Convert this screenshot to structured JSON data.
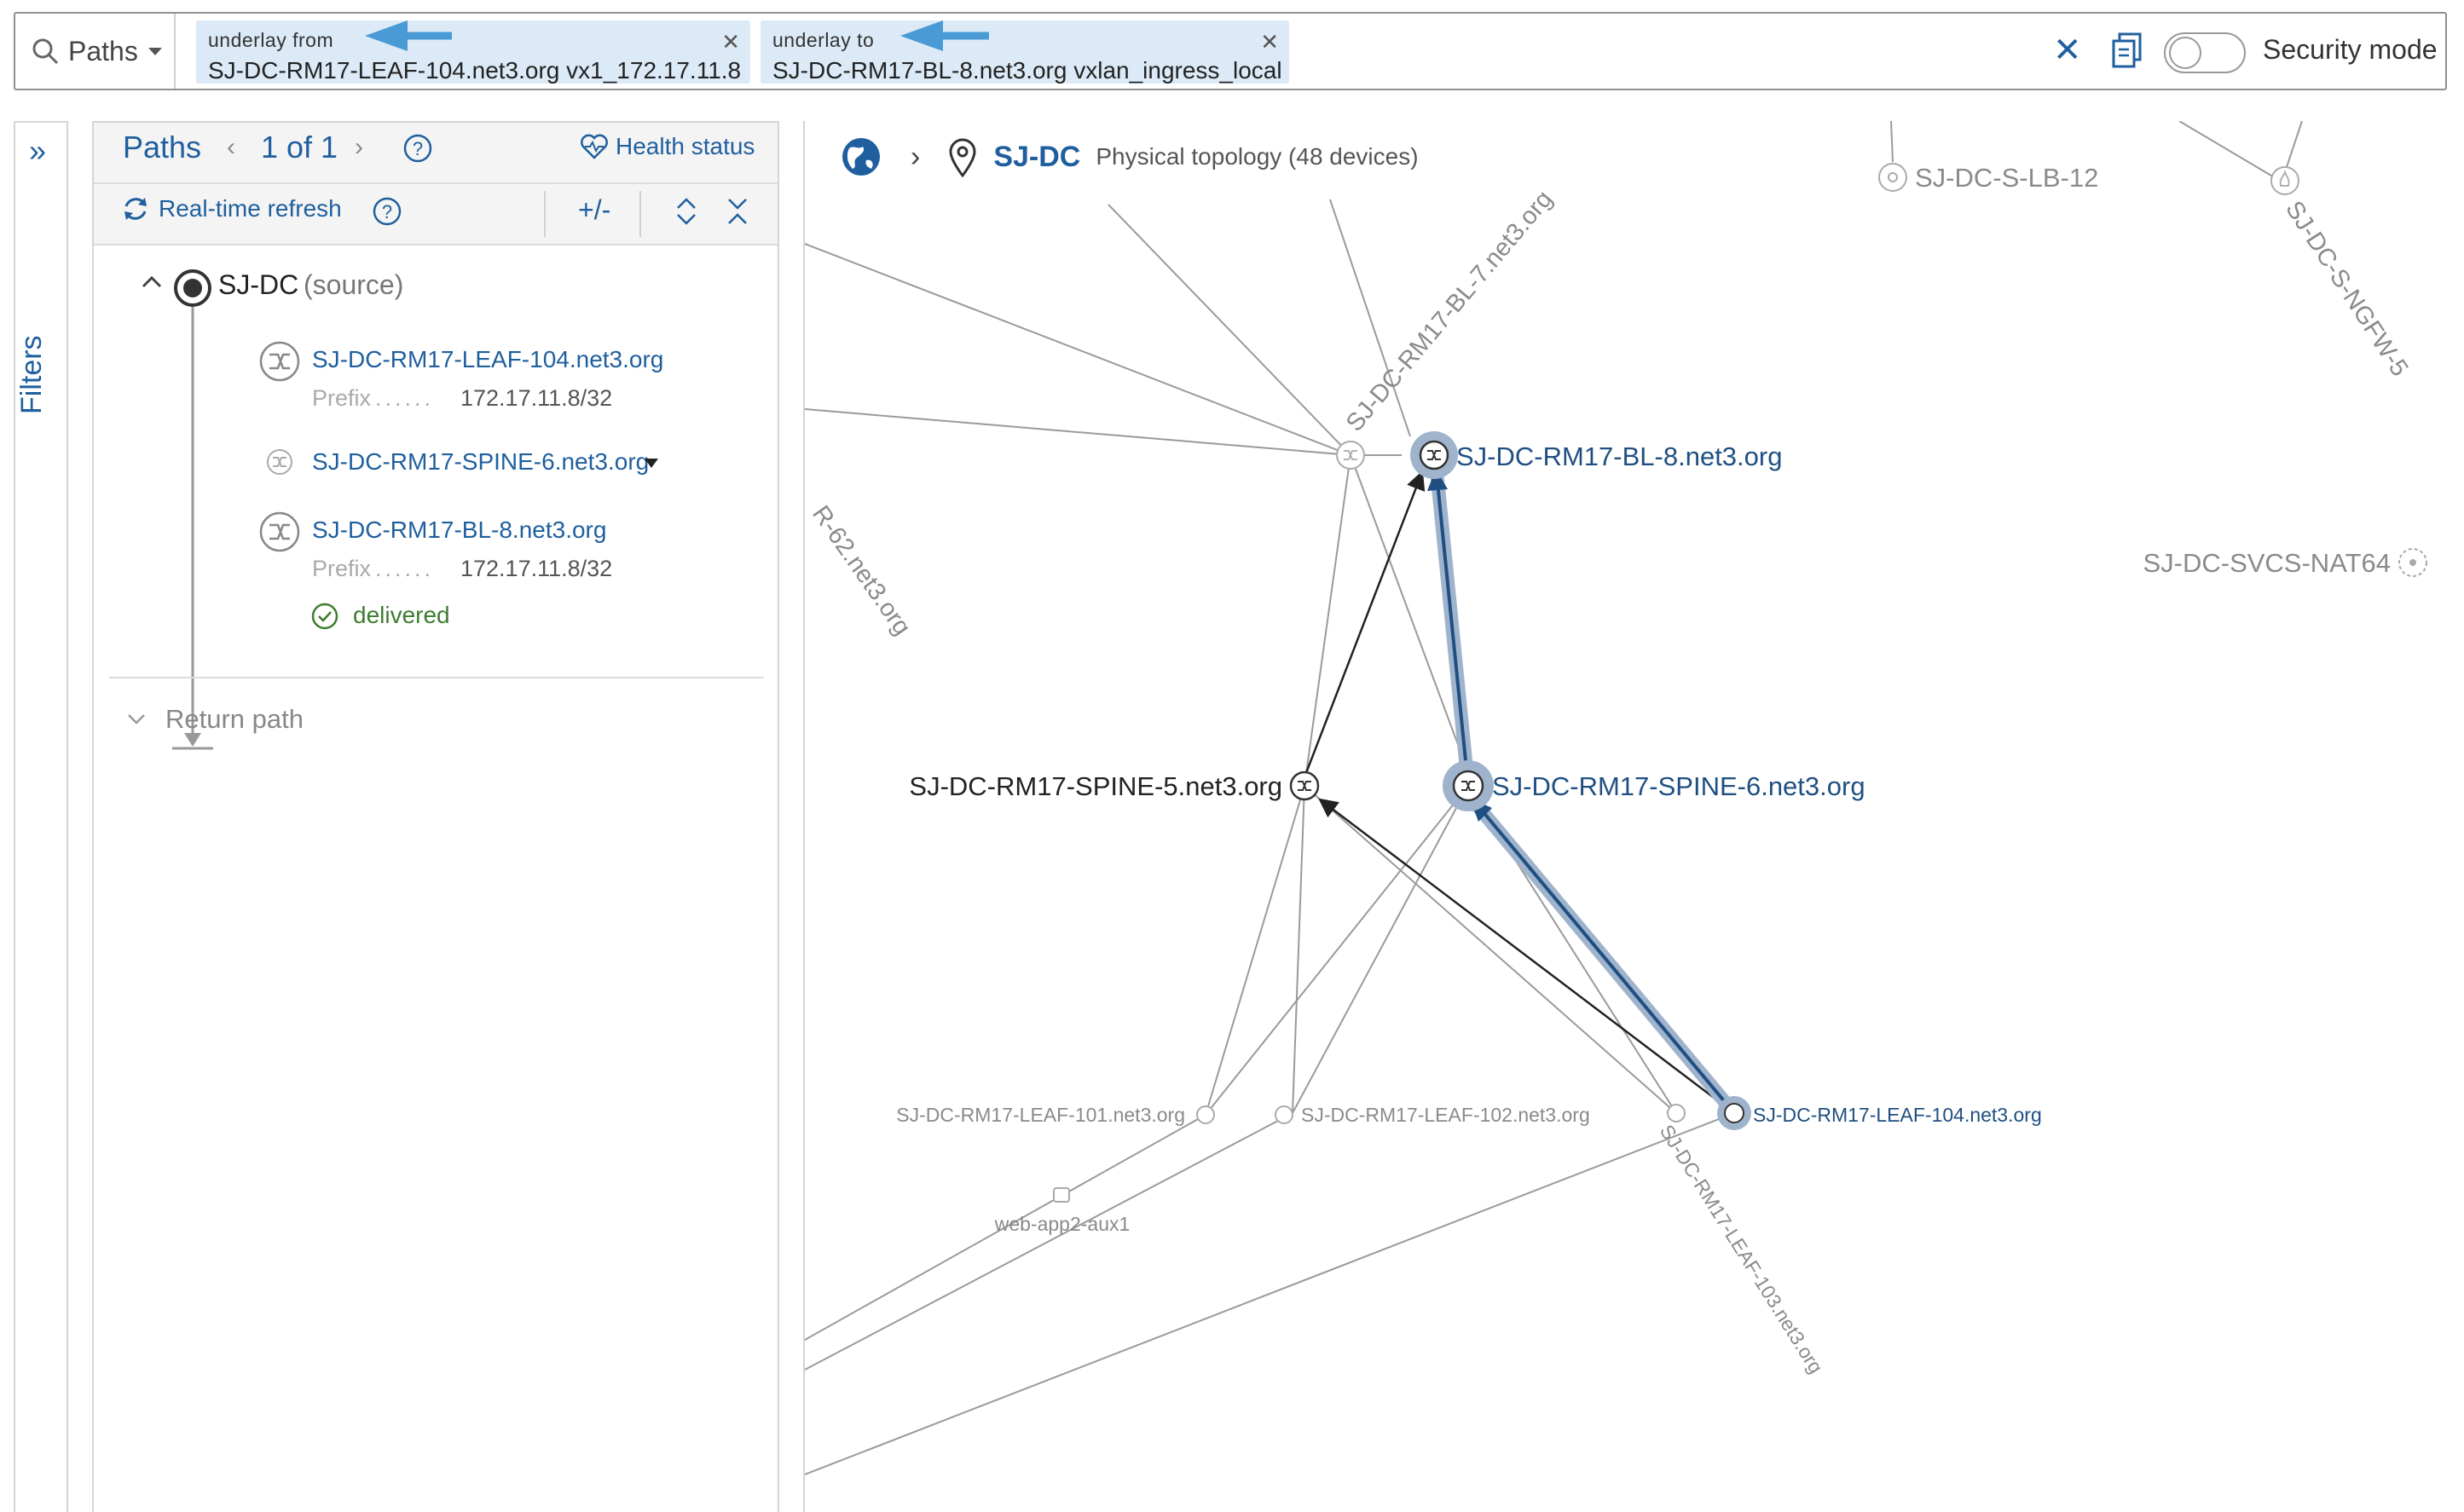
{
  "search": {
    "scope_label": "Paths",
    "chips": [
      {
        "label": "underlay  from",
        "value": "SJ-DC-RM17-LEAF-104.net3.org vx1_172.17.11.8"
      },
      {
        "label": "underlay  to",
        "value": "SJ-DC-RM17-BL-8.net3.org vxlan_ingress_local"
      }
    ],
    "security_mode_label": "Security mode"
  },
  "filters": {
    "label": "Filters"
  },
  "paths_panel": {
    "title": "Paths",
    "page": "1 of 1",
    "health_status_label": "Health status",
    "realtime_refresh_label": "Real-time refresh",
    "plus_minus_label": "+/-",
    "tree": {
      "source_name": "SJ-DC",
      "source_suffix": "(source)",
      "hops": [
        {
          "name": "SJ-DC-RM17-LEAF-104.net3.org",
          "prefix_label": "Prefix",
          "prefix_value": "172.17.11.8/32"
        },
        {
          "name": "SJ-DC-RM17-SPINE-6.net3.org"
        },
        {
          "name": "SJ-DC-RM17-BL-8.net3.org",
          "prefix_label": "Prefix",
          "prefix_value": "172.17.11.8/32"
        }
      ],
      "status": "delivered"
    },
    "return_path_label": "Return path"
  },
  "topology": {
    "site": "SJ-DC",
    "subtitle": "Physical topology (48 devices)",
    "nodes": {
      "bl8": "SJ-DC-RM17-BL-8.net3.org",
      "bl7": "SJ-DC-RM17-BL-7.net3.org",
      "spine5": "SJ-DC-RM17-SPINE-5.net3.org",
      "spine6": "SJ-DC-RM17-SPINE-6.net3.org",
      "leaf101": "SJ-DC-RM17-LEAF-101.net3.org",
      "leaf102": "SJ-DC-RM17-LEAF-102.net3.org",
      "leaf103": "SJ-DC-RM17-LEAF-103.net3.org",
      "leaf104": "SJ-DC-RM17-LEAF-104.net3.org",
      "lb12": "SJ-DC-S-LB-12",
      "ngfw5": "SJ-DC-S-NGFW-5",
      "nat64": "SJ-DC-SVCS-NAT64",
      "r62": "R-62.net3.org",
      "webapp": "web-app2-aux1"
    }
  },
  "colors": {
    "accent": "#1f5f9e",
    "chip_bg": "#dbeaf6",
    "path_halo": "#9fb4cc",
    "callout_arrow": "#4a9ad6",
    "delivered": "#3c7d2e"
  }
}
